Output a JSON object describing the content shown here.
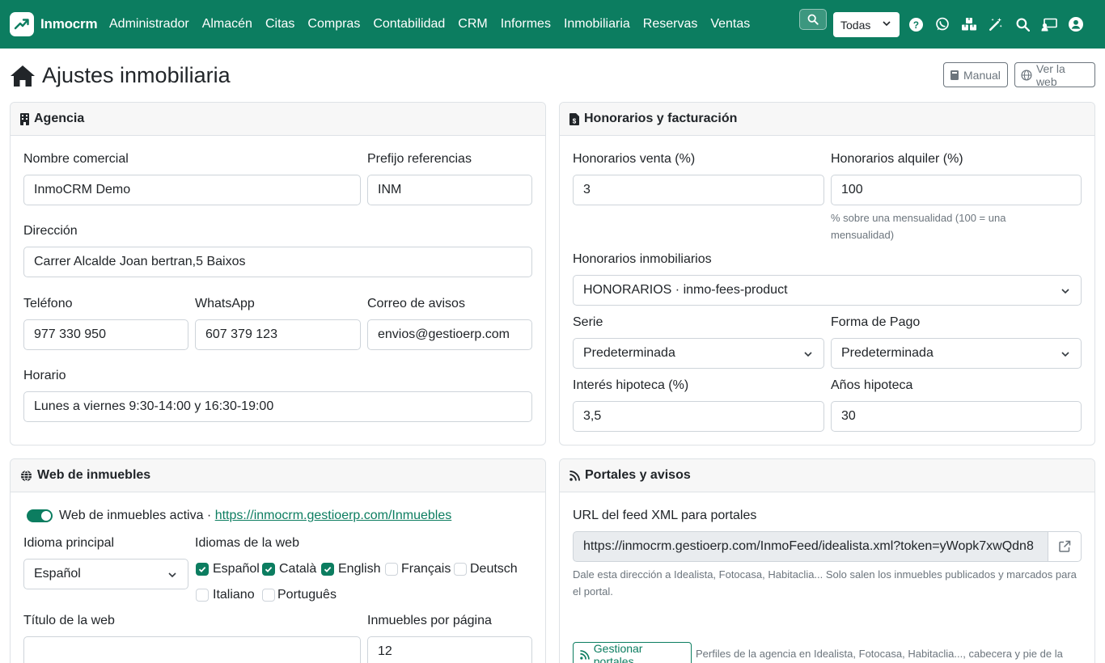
{
  "app": {
    "brand": "Inmocrm"
  },
  "nav": {
    "items": [
      "Administrador",
      "Almacén",
      "Citas",
      "Compras",
      "Contabilidad",
      "CRM",
      "Informes",
      "Inmobiliaria",
      "Reservas",
      "Ventas"
    ],
    "company_select": "Todas"
  },
  "page": {
    "title": "Ajustes inmobiliaria",
    "manual_label": "Manual",
    "ver_web_label": "Ver la web"
  },
  "agencia": {
    "title": "Agencia",
    "nombre_label": "Nombre comercial",
    "nombre_value": "InmoCRM Demo",
    "prefijo_label": "Prefijo referencias",
    "prefijo_value": "INM",
    "direccion_label": "Dirección",
    "direccion_value": "Carrer Alcalde Joan bertran,5 Baixos",
    "telefono_label": "Teléfono",
    "telefono_value": "977 330 950",
    "whatsapp_label": "WhatsApp",
    "whatsapp_value": "607 379 123",
    "correo_label": "Correo de avisos",
    "correo_value": "envios@gestioerp.com",
    "horario_label": "Horario",
    "horario_value": "Lunes a viernes 9:30-14:00 y 16:30-19:00"
  },
  "honorarios": {
    "title": "Honorarios y facturación",
    "venta_label": "Honorarios venta (%)",
    "venta_value": "3",
    "alquiler_label": "Honorarios alquiler (%)",
    "alquiler_value": "100",
    "alquiler_help": "% sobre una mensualidad (100 = una mensualidad)",
    "producto_label": "Honorarios inmobiliarios",
    "producto_value": "HONORARIOS · inmo-fees-product",
    "serie_label": "Serie",
    "serie_value": "Predeterminada",
    "forma_pago_label": "Forma de Pago",
    "forma_pago_value": "Predeterminada",
    "interes_label": "Interés hipoteca (%)",
    "interes_value": "3,5",
    "anos_label": "Años hipoteca",
    "anos_value": "30"
  },
  "web": {
    "title": "Web de inmuebles",
    "active_label": "Web de inmuebles activa",
    "separator": " · ",
    "url": "https://inmocrm.gestioerp.com/Inmuebles",
    "active": true,
    "idioma_label": "Idioma principal",
    "idioma_value": "Español",
    "idiomas_label": "Idiomas de la web",
    "languages": [
      {
        "label": "Español",
        "checked": true
      },
      {
        "label": "Català",
        "checked": true
      },
      {
        "label": "English",
        "checked": true
      },
      {
        "label": "Français",
        "checked": false
      },
      {
        "label": "Deutsch",
        "checked": false
      },
      {
        "label": "Italiano",
        "checked": false
      },
      {
        "label": "Português",
        "checked": false
      }
    ],
    "titulo_label": "Título de la web",
    "titulo_value": "",
    "por_pagina_label": "Inmuebles por página",
    "por_pagina_value": "12"
  },
  "portales": {
    "title": "Portales y avisos",
    "feed_label": "URL del feed XML para portales",
    "feed_value": "https://inmocrm.gestioerp.com/InmoFeed/idealista.xml?token=yWopk7xwQdn8",
    "feed_help": "Dale esta dirección a Idealista, Fotocasa, Habitaclia... Solo salen los inmuebles publicados y marcados para el portal.",
    "gestionar_label": "Gestionar portales",
    "gestionar_help": "Perfiles de la agencia en Idealista, Fotocasa, Habitaclia..., cabecera y pie de la"
  },
  "colors": {
    "primary": "#0c7d60",
    "border": "#dee2e6",
    "header_bg": "#f7f7f7",
    "muted": "#6c757d"
  }
}
